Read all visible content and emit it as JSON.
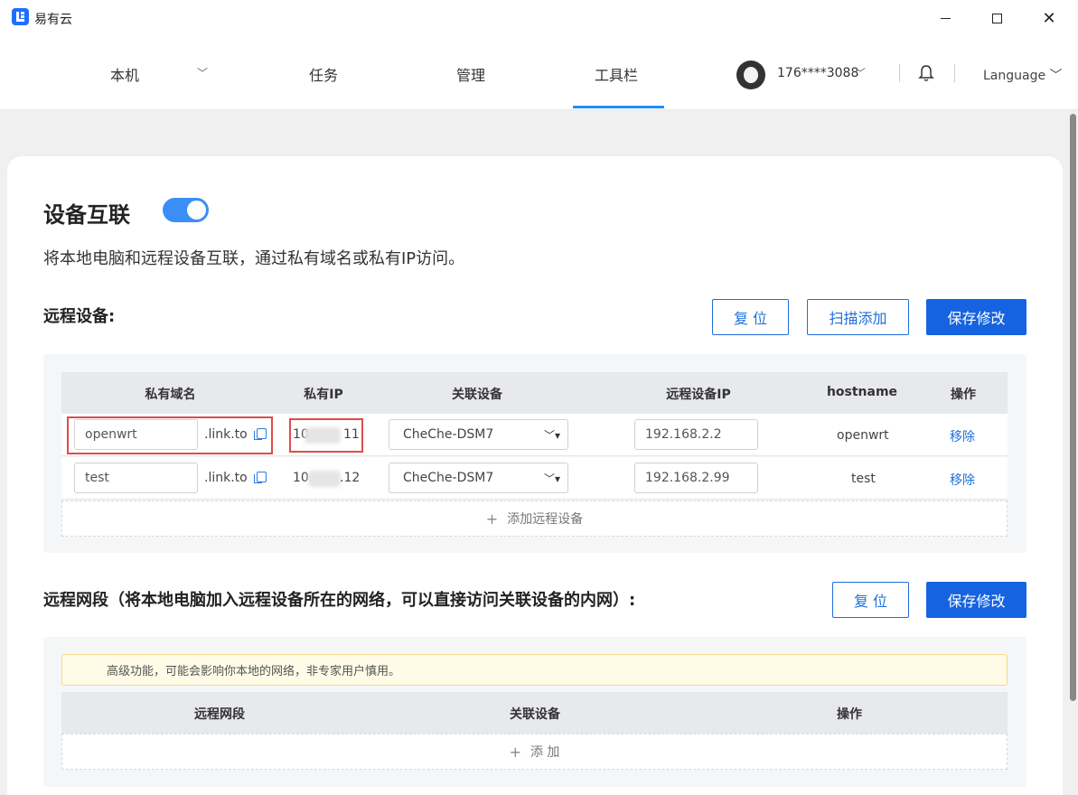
{
  "window": {
    "title": "易有云",
    "minimize_glyph": "—",
    "maximize_glyph": "□",
    "close_glyph": "✕"
  },
  "nav": {
    "local": "本机",
    "local_caret": "﹀",
    "tasks": "任务",
    "manage": "管理",
    "toolbar": "工具栏",
    "active": "toolbar",
    "user": "176****3088",
    "user_caret": "﹀",
    "language": "Language ﹀",
    "icons": [
      "avatar",
      "bell-icon"
    ]
  },
  "page": {
    "title": "设备互联",
    "toggle_on": true,
    "description": "将本地电脑和远程设备互联，通过私有域名或私有IP访问。"
  },
  "remote_devices": {
    "title": "远程设备:",
    "reset": "复 位",
    "scan_add": "扫描添加",
    "save": "保存修改",
    "columns": [
      "私有域名",
      "私有IP",
      "关联设备",
      "远程设备IP",
      "hostname",
      "操作"
    ],
    "rows": [
      {
        "domain": "openwrt",
        "suffix": ".link.to",
        "ip_prefix": "10",
        "ip_suffix": "11",
        "device": "CheChe-DSM7",
        "device_caret": "﹀▾",
        "remote_ip": "192.168.2.2",
        "hostname": "openwrt",
        "action": "移除"
      },
      {
        "domain": "test",
        "suffix": ".link.to",
        "ip_prefix": "10.",
        "ip_suffix": ".12",
        "device": "CheChe-DSM7",
        "device_caret": "﹀▾",
        "remote_ip": "192.168.2.99",
        "hostname": "test",
        "action": "移除"
      }
    ],
    "add_plus": "+",
    "add_label": "添加远程设备"
  },
  "remote_segments": {
    "title": "远程网段（将本地电脑加入远程设备所在的网络，可以直接访问关联设备的内网）:",
    "reset": "复 位",
    "save": "保存修改",
    "notice": "高级功能，可能会影响你本地的网络，非专家用户慎用。",
    "columns": [
      "远程网段",
      "关联设备",
      "操作"
    ],
    "add_plus": "+",
    "add_label": "添 加"
  },
  "colors": {
    "accent": "#1e6fdc",
    "primary_button": "#1563e0",
    "toggle": "#3a8ef6",
    "highlight_box": "#e04b4b",
    "notice_bg": "#fffbe6"
  }
}
